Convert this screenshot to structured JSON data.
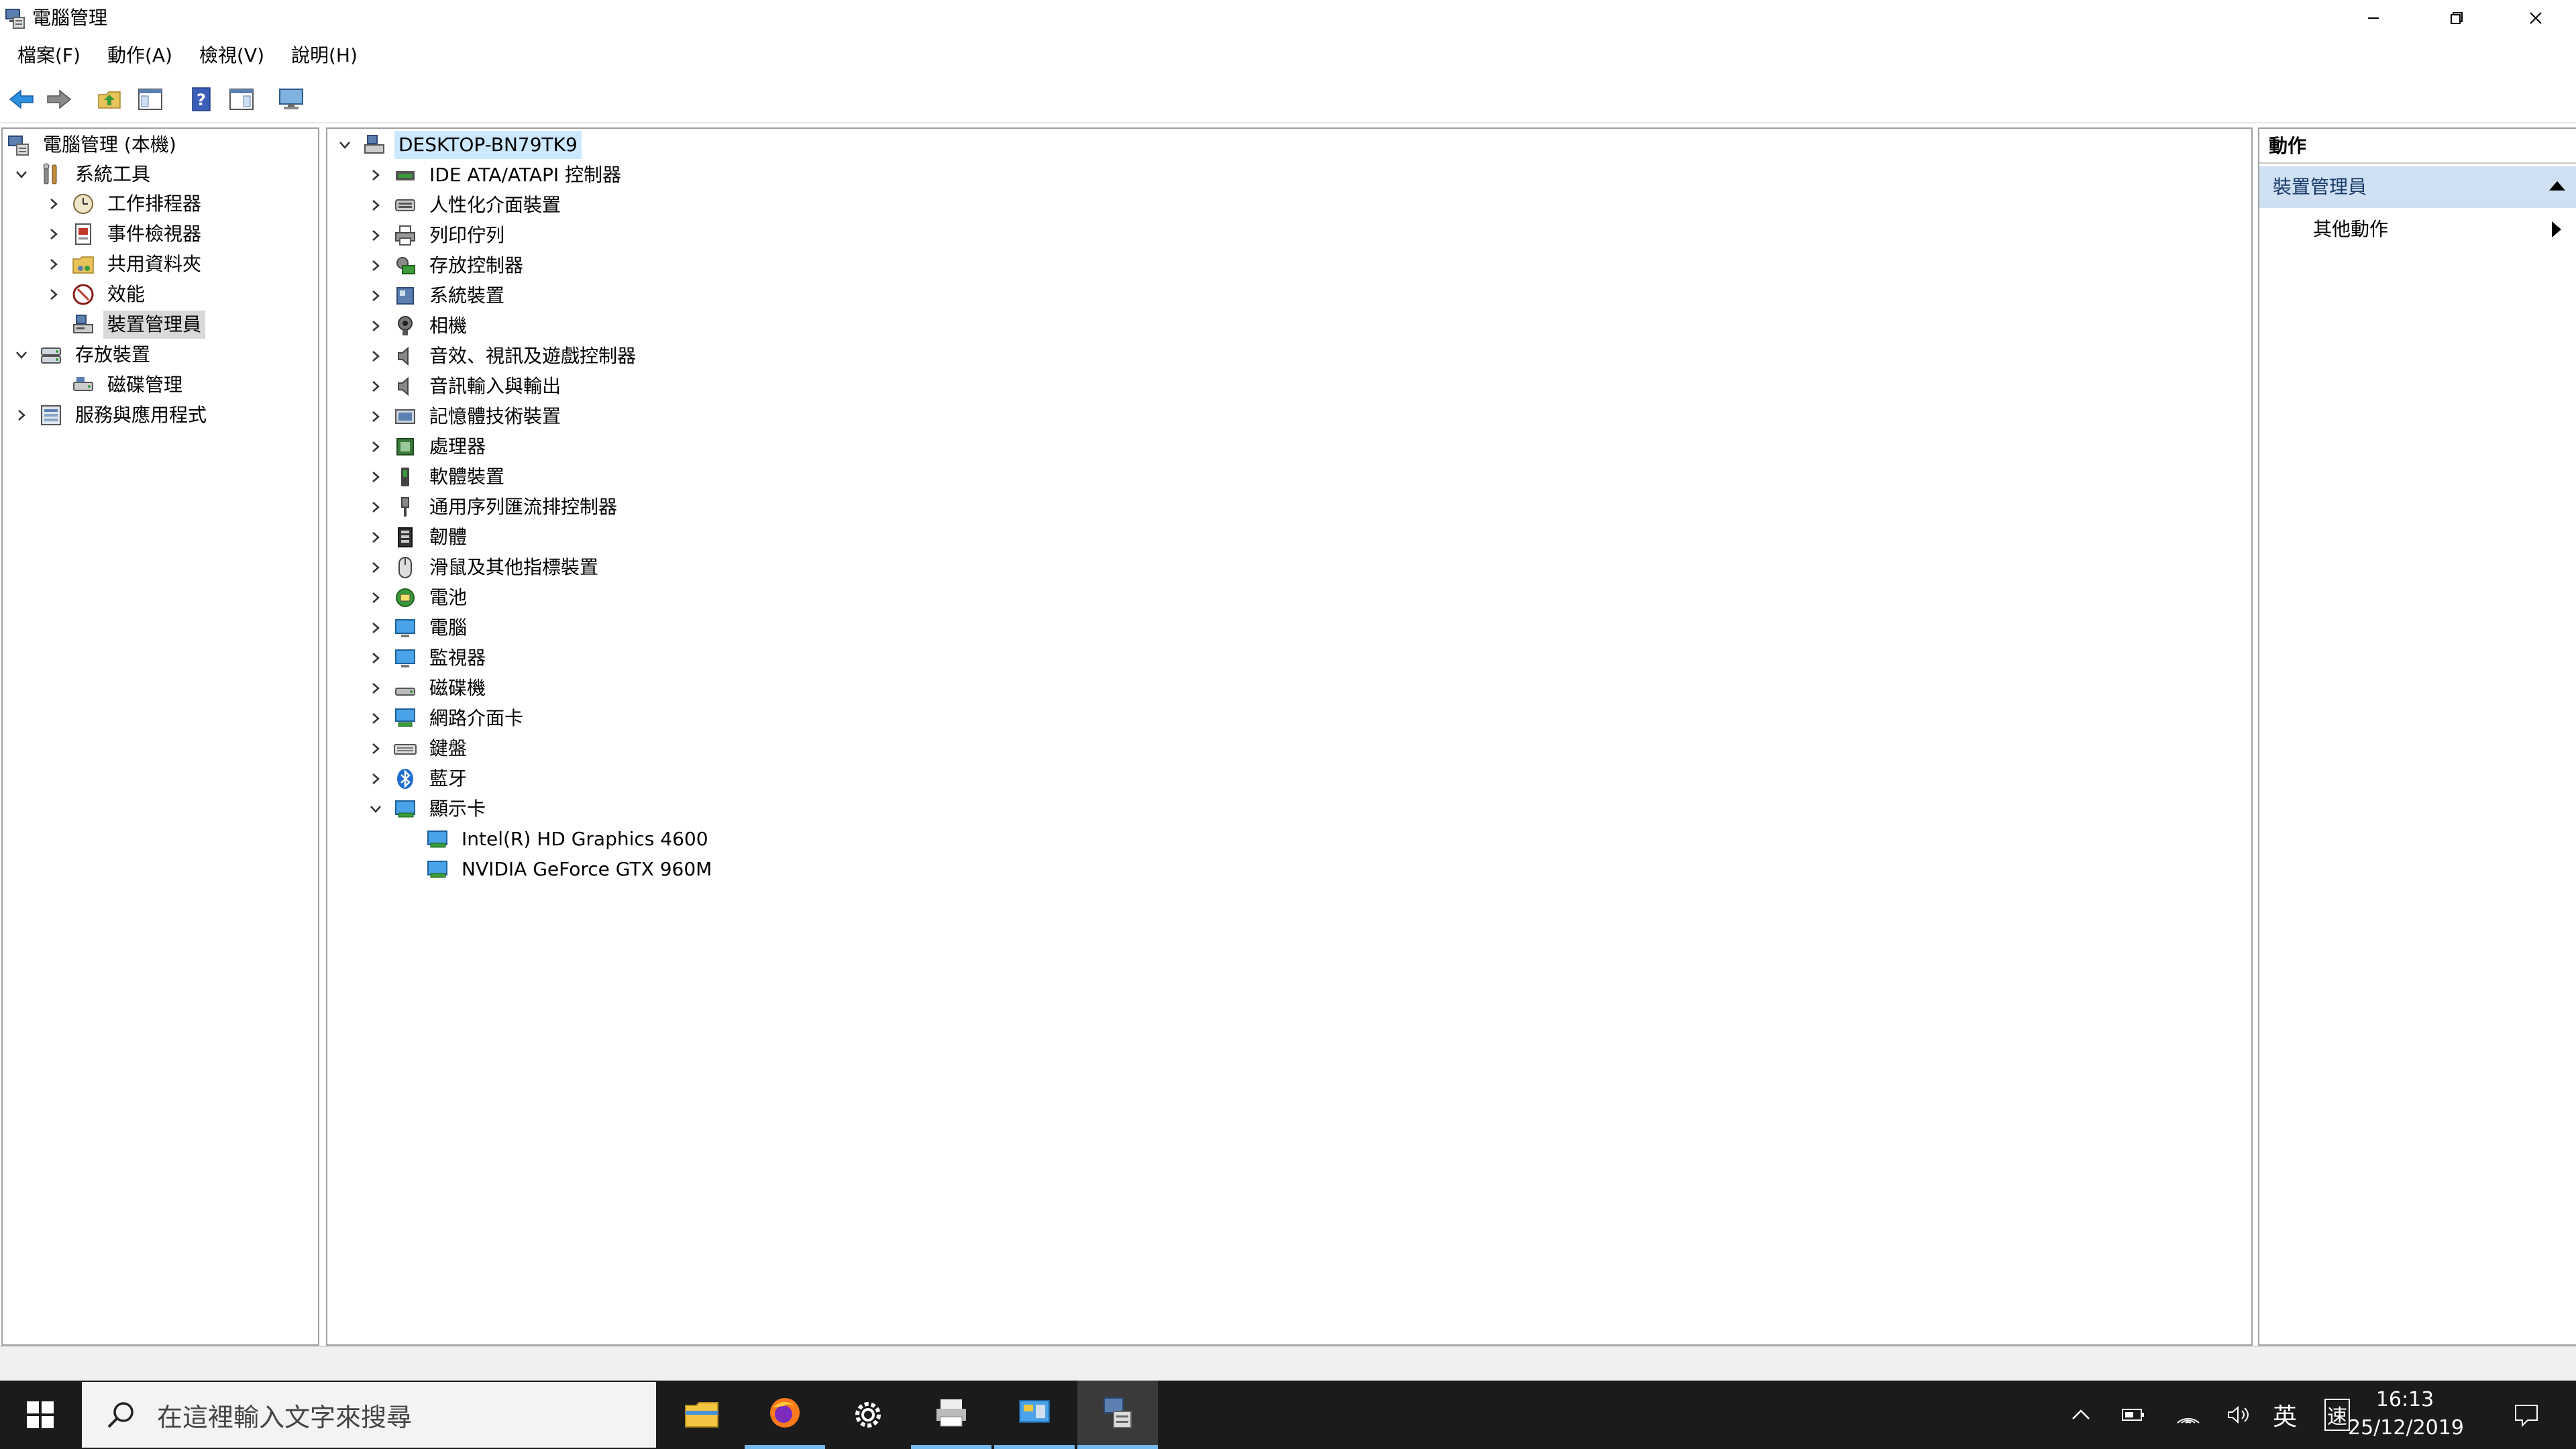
{
  "window": {
    "title": "電腦管理",
    "controls": {
      "minimize": "minimize-icon",
      "restore": "restore-icon",
      "close": "close-icon"
    }
  },
  "menu": [
    "檔案(F)",
    "動作(A)",
    "檢視(V)",
    "說明(H)"
  ],
  "toolbar": {
    "icons": [
      "back-arrow-icon",
      "forward-arrow-icon",
      "up-folder-icon",
      "show-hide-console-tree-icon",
      "help-icon",
      "show-hide-action-pane-icon",
      "monitor-icon"
    ]
  },
  "left_tree": {
    "root": "電腦管理 (本機)",
    "system_tools": "系統工具",
    "task_scheduler": "工作排程器",
    "event_viewer": "事件檢視器",
    "shared_folders": "共用資料夾",
    "performance": "效能",
    "device_manager": "裝置管理員",
    "storage": "存放裝置",
    "disk_management": "磁碟管理",
    "services_apps": "服務與應用程式"
  },
  "device_tree": {
    "root": "DESKTOP-BN79TK9",
    "categories": [
      "IDE ATA/ATAPI 控制器",
      "人性化介面裝置",
      "列印佇列",
      "存放控制器",
      "系統裝置",
      "相機",
      "音效、視訊及遊戲控制器",
      "音訊輸入與輸出",
      "記憶體技術裝置",
      "處理器",
      "軟體裝置",
      "通用序列匯流排控制器",
      "韌體",
      "滑鼠及其他指標裝置",
      "電池",
      "電腦",
      "監視器",
      "磁碟機",
      "網路介面卡",
      "鍵盤",
      "藍牙",
      "顯示卡"
    ],
    "display_adapters": [
      "Intel(R) HD Graphics 4600",
      "NVIDIA GeForce GTX 960M"
    ]
  },
  "actions": {
    "header": "動作",
    "section": "裝置管理員",
    "more": "其他動作"
  },
  "taskbar": {
    "search_placeholder": "在這裡輸入文字來搜尋",
    "apps": [
      "file-explorer-icon",
      "firefox-icon",
      "settings-icon",
      "printer-app-icon",
      "control-panel-icon",
      "computer-management-icon"
    ],
    "tray": {
      "ime_lang": "英",
      "ime_mode": "速"
    },
    "time": "16:13",
    "date": "25/12/2019"
  },
  "colors": {
    "selection_blue": "#cce8ff",
    "action_section": "#cfe0f3",
    "taskbar": "#1b1b1b",
    "accent": "#76b9ed"
  }
}
